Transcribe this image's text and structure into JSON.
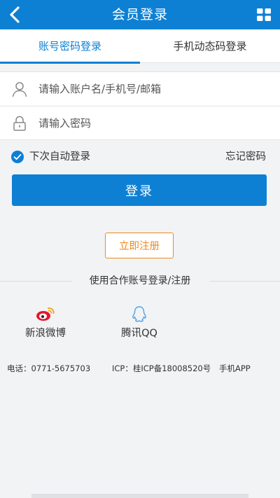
{
  "header": {
    "title": "会员登录",
    "back_icon": "chevron-left-icon",
    "menu_icon": "grid-icon"
  },
  "tabs": [
    {
      "label": "账号密码登录",
      "active": true
    },
    {
      "label": "手机动态码登录",
      "active": false
    }
  ],
  "form": {
    "username": {
      "value": "",
      "placeholder": "请输入账户名/手机号/邮箱",
      "icon": "user-icon"
    },
    "password": {
      "value": "",
      "placeholder": "请输入密码",
      "icon": "lock-icon"
    }
  },
  "options": {
    "auto_login_label": "下次自动登录",
    "auto_login_checked": true,
    "forgot_label": "忘记密码"
  },
  "login_button": "登录",
  "register_button": "立即注册",
  "partner": {
    "heading": "使用合作账号登录/注册",
    "providers": [
      {
        "label": "新浪微博",
        "icon": "weibo-icon"
      },
      {
        "label": "腾讯QQ",
        "icon": "qq-icon"
      }
    ]
  },
  "footer": {
    "phone": "电话：0771-5675703",
    "icp": "ICP：桂ICP备18008520号",
    "app": "手机APP"
  },
  "colors": {
    "primary": "#0d80d4",
    "accent": "#f08a1c",
    "background": "#f2f3f5",
    "weibo": "#e6162d",
    "qq": "#4da3e6"
  }
}
